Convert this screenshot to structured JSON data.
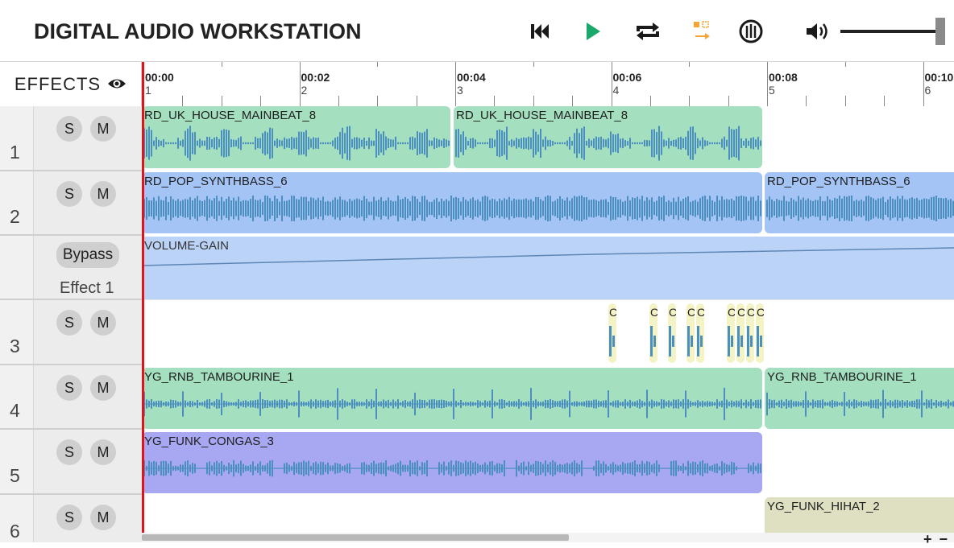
{
  "app": {
    "title": "DIGITAL AUDIO WORKSTATION"
  },
  "toolbar": {
    "buttons": [
      {
        "name": "skip-to-start-icon",
        "color": "#1a1a1a"
      },
      {
        "name": "play-icon",
        "color": "#1aa86b"
      },
      {
        "name": "loop-icon",
        "color": "#1a1a1a"
      },
      {
        "name": "follow-playhead-icon",
        "color": "#f3a536"
      },
      {
        "name": "metronome-icon",
        "color": "#1a1a1a"
      },
      {
        "name": "volume-icon",
        "color": "#1a1a1a"
      }
    ],
    "volume_level": 1.0
  },
  "effects_header": {
    "label": "EFFECTS"
  },
  "ruler": {
    "marks": [
      {
        "time": "00:00",
        "measure": "1"
      },
      {
        "time": "00:02",
        "measure": "2"
      },
      {
        "time": "00:04",
        "measure": "3"
      },
      {
        "time": "00:06",
        "measure": "4"
      },
      {
        "time": "00:08",
        "measure": "5"
      },
      {
        "time": "00:10",
        "measure": "6"
      }
    ]
  },
  "tracks": [
    {
      "number": "1",
      "solo": "S",
      "mute": "M"
    },
    {
      "number": "2",
      "solo": "S",
      "mute": "M"
    },
    {
      "number": "3",
      "solo": "S",
      "mute": "M"
    },
    {
      "number": "4",
      "solo": "S",
      "mute": "M"
    },
    {
      "number": "5",
      "solo": "S",
      "mute": "M"
    },
    {
      "number": "6",
      "solo": "S",
      "mute": "M"
    }
  ],
  "effect_row": {
    "bypass_label": "Bypass",
    "effect_name": "Effect 1",
    "lane_label": "VOLUME-GAIN"
  },
  "clips": {
    "t1a": "RD_UK_HOUSE_MAINBEAT_8",
    "t1b": "RD_UK_HOUSE_MAINBEAT_8",
    "t2a": "RD_POP_SYNTHBASS_6",
    "t2b": "RD_POP_SYNTHBASS_6",
    "t4a": "YG_RNB_TAMBOURINE_1",
    "t4b": "YG_RNB_TAMBOURINE_1",
    "t5a": "YG_FUNK_CONGAS_3",
    "t6a": "YG_FUNK_HIHAT_2",
    "t3_clip_label": "C"
  },
  "colors": {
    "green_clip": "#a4e0bf",
    "blue_clip": "#a4c4f6",
    "effect_lane": "#bcd3f8",
    "purple_clip": "#a8a8f2",
    "khaki_clip": "#dfe0c2",
    "wave": "#4b8fc0",
    "playhead": "#e0151b"
  },
  "zoom": {
    "label": "+ −"
  }
}
